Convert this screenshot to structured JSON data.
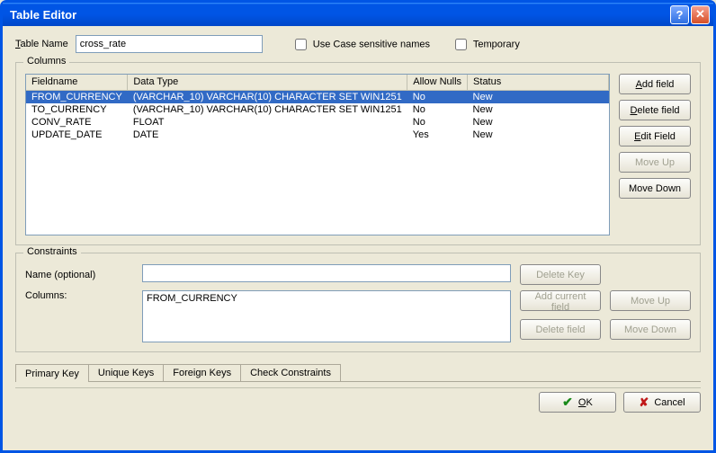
{
  "window": {
    "title": "Table Editor"
  },
  "form": {
    "table_name_label": "Table Name",
    "table_name_value": "cross_rate",
    "use_case_label": "Use Case sensitive names",
    "use_case_checked": false,
    "temporary_label": "Temporary",
    "temporary_checked": false
  },
  "columns": {
    "legend": "Columns",
    "headers": {
      "fieldname": "Fieldname",
      "datatype": "Data Type",
      "allow_nulls": "Allow Nulls",
      "status": "Status"
    },
    "rows": [
      {
        "fieldname": "FROM_CURRENCY",
        "datatype": "(VARCHAR_10) VARCHAR(10) CHARACTER SET WIN1251",
        "allow_nulls": "No",
        "status": "New",
        "selected": true
      },
      {
        "fieldname": "TO_CURRENCY",
        "datatype": "(VARCHAR_10) VARCHAR(10) CHARACTER SET WIN1251",
        "allow_nulls": "No",
        "status": "New",
        "selected": false
      },
      {
        "fieldname": "CONV_RATE",
        "datatype": "FLOAT",
        "allow_nulls": "No",
        "status": "New",
        "selected": false
      },
      {
        "fieldname": "UPDATE_DATE",
        "datatype": "DATE",
        "allow_nulls": "Yes",
        "status": "New",
        "selected": false
      }
    ],
    "buttons": {
      "add": "Add field",
      "delete": "Delete field",
      "edit": "Edit Field",
      "moveup": "Move Up",
      "movedown": "Move Down"
    }
  },
  "constraints": {
    "legend": "Constraints",
    "name_label": "Name (optional)",
    "name_value": "",
    "columns_label": "Columns:",
    "columns_value": "FROM_CURRENCY",
    "buttons": {
      "delete_key": "Delete Key",
      "add_current": "Add current field",
      "delete_field": "Delete field",
      "moveup": "Move Up",
      "movedown": "Move Down"
    }
  },
  "tabs": [
    {
      "label": "Primary Key",
      "active": true
    },
    {
      "label": "Unique Keys",
      "active": false
    },
    {
      "label": "Foreign Keys",
      "active": false
    },
    {
      "label": "Check Constraints",
      "active": false
    }
  ],
  "bottom": {
    "ok": "OK",
    "cancel": "Cancel"
  }
}
